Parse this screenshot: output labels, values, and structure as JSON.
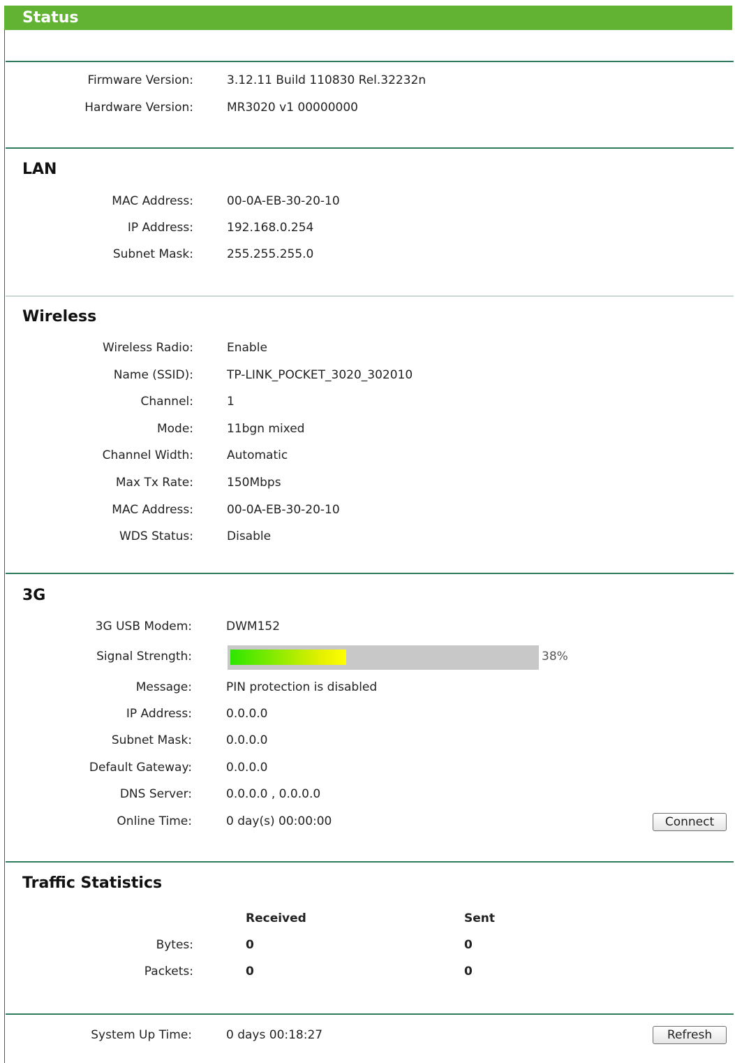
{
  "header": {
    "title": "Status"
  },
  "general": {
    "firmware_label": "Firmware Version:",
    "firmware_value": "3.12.11 Build 110830 Rel.32232n",
    "hardware_label": "Hardware Version:",
    "hardware_value": "MR3020 v1 00000000"
  },
  "lan": {
    "title": "LAN",
    "mac_label": "MAC Address:",
    "mac_value": "00-0A-EB-30-20-10",
    "ip_label": "IP Address:",
    "ip_value": "192.168.0.254",
    "mask_label": "Subnet Mask:",
    "mask_value": "255.255.255.0"
  },
  "wireless": {
    "title": "Wireless",
    "radio_label": "Wireless Radio:",
    "radio_value": "Enable",
    "ssid_label": "Name (SSID):",
    "ssid_value": "TP-LINK_POCKET_3020_302010",
    "channel_label": "Channel:",
    "channel_value": "1",
    "mode_label": "Mode:",
    "mode_value": "11bgn mixed",
    "width_label": "Channel Width:",
    "width_value": "Automatic",
    "rate_label": "Max Tx Rate:",
    "rate_value": "150Mbps",
    "mac_label": "MAC Address:",
    "mac_value": "00-0A-EB-30-20-10",
    "wds_label": "WDS Status:",
    "wds_value": "Disable"
  },
  "g3": {
    "title": "3G",
    "modem_label": "3G USB Modem:",
    "modem_value": "DWM152",
    "signal_label": "Signal Strength:",
    "signal_text": "38%",
    "signal_fraction": 0.38,
    "message_label": "Message:",
    "message_value": "PIN protection is disabled",
    "ip_label": "IP Address:",
    "ip_value": "0.0.0.0",
    "mask_label": "Subnet Mask:",
    "mask_value": "0.0.0.0",
    "gateway_label": "Default Gateway:",
    "gateway_value": "0.0.0.0",
    "dns_label": "DNS Server:",
    "dns_value": "0.0.0.0 , 0.0.0.0",
    "online_label": "Online Time:",
    "online_value": "0 day(s) 00:00:00",
    "connect_label": "Connect"
  },
  "traffic": {
    "title": "Traffic Statistics",
    "received_header": "Received",
    "sent_header": "Sent",
    "bytes_label": "Bytes:",
    "bytes_received": "0",
    "bytes_sent": "0",
    "packets_label": "Packets:",
    "packets_received": "0",
    "packets_sent": "0"
  },
  "system": {
    "uptime_label": "System Up Time:",
    "uptime_value": "0 days 00:18:27",
    "refresh_label": "Refresh"
  },
  "colors": {
    "header_bg": "#62b233",
    "rule": "#2f7a5a"
  }
}
